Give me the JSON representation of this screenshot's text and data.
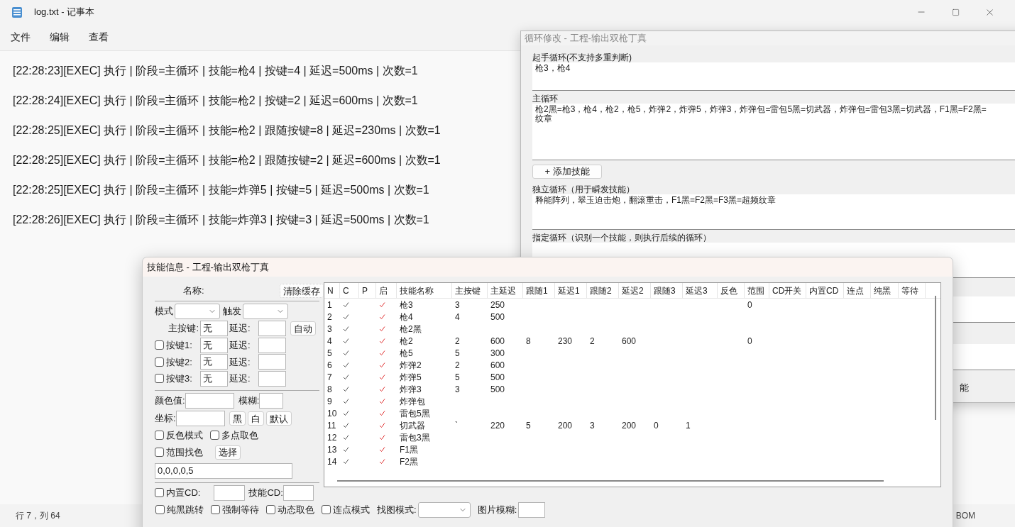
{
  "notepad": {
    "title": "log.txt - 记事本",
    "menu": [
      "文件",
      "编辑",
      "查看"
    ],
    "lines": [
      "[22:28:23][EXEC] 执行 | 阶段=主循环 | 技能=枪4 | 按键=4 | 延迟=500ms | 次数=1",
      "[22:28:24][EXEC] 执行 | 阶段=主循环 | 技能=枪2 | 按键=2 | 延迟=600ms | 次数=1",
      "[22:28:25][EXEC] 执行 | 阶段=主循环 | 技能=枪2 | 跟随按键=8 | 延迟=230ms | 次数=1",
      "[22:28:25][EXEC] 执行 | 阶段=主循环 | 技能=枪2 | 跟随按键=2 | 延迟=600ms | 次数=1",
      "[22:28:25][EXEC] 执行 | 阶段=主循环 | 技能=炸弹5 | 按键=5 | 延迟=500ms | 次数=1",
      "[22:28:26][EXEC] 执行 | 阶段=主循环 | 技能=炸弹3 | 按键=3 | 延迟=500ms | 次数=1"
    ],
    "status": {
      "position": "行 7，列 64",
      "encoding": "BOM"
    }
  },
  "loop_window": {
    "title": "循环修改 - 工程-输出双枪丁真",
    "sections": [
      {
        "label": "起手循环(不支持多重判断)",
        "lines": [
          "枪3，枪4"
        ]
      },
      {
        "label": "主循环",
        "lines": [
          "枪2黑=枪3，枪4，枪2，枪5，炸弹2，炸弹5，炸弹3，炸弹包=雷包5黑=切武器，炸弹包=雷包3黑=切武器，F1黑=F2黑=",
          "纹章"
        ]
      },
      {
        "label": "独立循环（用于瞬发技能）",
        "lines": [
          "释能阵列，翠玉迫击炮，翻滚重击，F1黑=F2黑=F3黑=超频纹章"
        ]
      },
      {
        "label": "指定循环（识别一个技能，则执行后续的循环）"
      }
    ],
    "add_button": "+ 添加技能",
    "partial_button": "能"
  },
  "skill_window": {
    "title": "技能信息 - 工程-输出双枪丁真",
    "name_label": "名称:",
    "clear_button": "清除缓存",
    "mode_label": "模式",
    "trigger_label": "触发",
    "main_key": {
      "label": "主按键:",
      "value": "无",
      "delay_label": "延迟:",
      "auto_button": "自动"
    },
    "keys": [
      {
        "label": "按键1:",
        "checked": false,
        "value": "无",
        "delay_label": "延迟:"
      },
      {
        "label": "按键2:",
        "checked": false,
        "value": "无",
        "delay_label": "延迟:"
      },
      {
        "label": "按键3:",
        "checked": false,
        "value": "无",
        "delay_label": "延迟:"
      }
    ],
    "color_label": "颜色值:",
    "blur_label": "模糊:",
    "coord_label": "坐标:",
    "coord_buttons": [
      "黑",
      "白",
      "默认"
    ],
    "options": [
      {
        "label": "反色模式",
        "checked": false
      },
      {
        "label": "多点取色",
        "checked": false
      }
    ],
    "range": {
      "label": "范围找色",
      "checked": false,
      "button": "选择"
    },
    "region_value": "0,0,0,0,5",
    "cd": {
      "label": "内置CD:",
      "checked": false,
      "skill_cd_label": "技能CD:"
    },
    "bottom_options": [
      {
        "label": "纯黑跳转",
        "checked": false
      },
      {
        "label": "强制等待",
        "checked": false
      },
      {
        "label": "动态取色",
        "checked": false
      },
      {
        "label": "连点模式",
        "checked": false
      }
    ],
    "find_mode_label": "找图模式:",
    "image_blur_label": "图片模糊:",
    "table": {
      "columns": [
        "N",
        "C",
        "P",
        "启",
        "技能名称",
        "主按键",
        "主延迟",
        "跟随1",
        "延迟1",
        "跟随2",
        "延迟2",
        "跟随3",
        "延迟3",
        "反色",
        "范围",
        "CD开关",
        "内置CD",
        "连点",
        "纯黑",
        "等待"
      ],
      "rows": [
        {
          "n": "1",
          "c": true,
          "p": false,
          "enabled": true,
          "name": "枪3",
          "cells": {
            "5": "3",
            "6": "250",
            "14": "0"
          }
        },
        {
          "n": "2",
          "c": true,
          "p": false,
          "enabled": true,
          "name": "枪4",
          "cells": {
            "5": "4",
            "6": "500"
          }
        },
        {
          "n": "3",
          "c": true,
          "p": false,
          "enabled": true,
          "name": "枪2黑",
          "cells": {}
        },
        {
          "n": "4",
          "c": true,
          "p": false,
          "enabled": true,
          "name": "枪2",
          "cells": {
            "5": "2",
            "6": "600",
            "7": "8",
            "8": "230",
            "9": "2",
            "10": "600",
            "14": "0"
          }
        },
        {
          "n": "5",
          "c": true,
          "p": false,
          "enabled": true,
          "name": "枪5",
          "cells": {
            "5": "5",
            "6": "300"
          }
        },
        {
          "n": "6",
          "c": true,
          "p": false,
          "enabled": true,
          "name": "炸弹2",
          "cells": {
            "5": "2",
            "6": "600"
          }
        },
        {
          "n": "7",
          "c": true,
          "p": false,
          "enabled": true,
          "name": "炸弹5",
          "cells": {
            "5": "5",
            "6": "500"
          }
        },
        {
          "n": "8",
          "c": true,
          "p": false,
          "enabled": true,
          "name": "炸弹3",
          "cells": {
            "5": "3",
            "6": "500"
          }
        },
        {
          "n": "9",
          "c": true,
          "p": false,
          "enabled": true,
          "name": "炸弹包",
          "cells": {}
        },
        {
          "n": "10",
          "c": true,
          "p": false,
          "enabled": true,
          "name": "雷包5黑",
          "cells": {}
        },
        {
          "n": "11",
          "c": true,
          "p": false,
          "enabled": true,
          "name": "切武器",
          "cells": {
            "5": "`",
            "6": "220",
            "7": "5",
            "8": "200",
            "9": "3",
            "10": "200",
            "11": "0",
            "12": "1"
          }
        },
        {
          "n": "12",
          "c": true,
          "p": false,
          "enabled": true,
          "name": "雷包3黑",
          "cells": {}
        },
        {
          "n": "13",
          "c": true,
          "p": false,
          "enabled": true,
          "name": "F1黑",
          "cells": {}
        },
        {
          "n": "14",
          "c": true,
          "p": false,
          "enabled": true,
          "name": "F2黑",
          "cells": {}
        }
      ]
    }
  }
}
